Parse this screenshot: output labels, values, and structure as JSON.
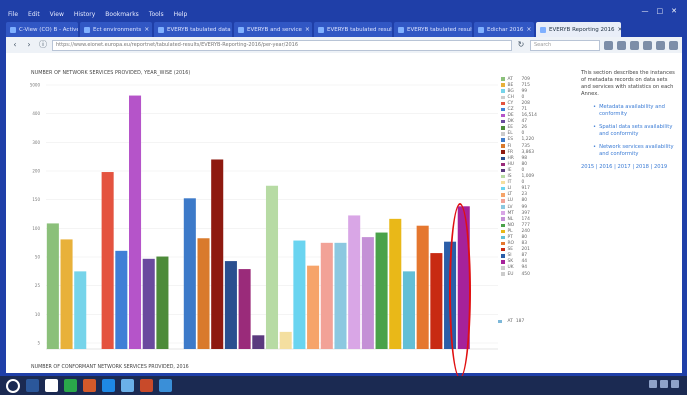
{
  "browser": {
    "menu": [
      "File",
      "Edit",
      "View",
      "History",
      "Bookmarks",
      "Tools",
      "Help"
    ],
    "window_controls": [
      "—",
      "□",
      "✕"
    ],
    "tabs": [
      {
        "label": "C-View (CO) B - Active"
      },
      {
        "label": "Ect environments"
      },
      {
        "label": "EVERYB tabulated data in"
      },
      {
        "label": "EVERYB and service"
      },
      {
        "label": "EVERYB tabulated results"
      },
      {
        "label": "EVERYB tabulated results"
      },
      {
        "label": "Edichar 2016"
      },
      {
        "label": "EVERYB Reporting 2016",
        "active": true
      }
    ],
    "url": "https://www.eionet.europa.eu/reportnet/tabulated-results/EVERYB-Reporting-2016/per-year/2016",
    "search_placeholder": "Search"
  },
  "chart1": {
    "title": "NUMBER OF NETWORK SERVICES PROVIDED, YEAR_WISE (2016)"
  },
  "chart_data": {
    "type": "bar",
    "categories": [
      "AT",
      "BE",
      "BG",
      "CH",
      "CY",
      "CZ",
      "DE",
      "DK",
      "EE",
      "EL",
      "ES",
      "FI",
      "FR",
      "HR",
      "HU",
      "IE",
      "IS",
      "IT",
      "LI",
      "LT",
      "LU",
      "LV",
      "MT",
      "NL",
      "NO",
      "PL",
      "PT",
      "RO",
      "SE",
      "SI",
      "SK",
      "UK",
      "EU"
    ],
    "values": [
      110,
      96,
      68,
      0,
      155,
      86,
      222,
      79,
      81,
      0,
      132,
      97,
      166,
      77,
      70,
      12,
      143,
      15,
      95,
      73,
      93,
      93,
      117,
      98,
      102,
      114,
      68,
      108,
      84,
      94,
      125,
      0,
      0
    ],
    "colors": [
      "#8bc07a",
      "#e8b13a",
      "#76d4ea",
      "#ffffff",
      "#e4533f",
      "#3f7fd6",
      "#b554c9",
      "#6a4a9e",
      "#4d8b3a",
      "#ffffff",
      "#3d7ac9",
      "#d97a2c",
      "#8e1a10",
      "#2a4f8f",
      "#9a2b7a",
      "#5a3a7e",
      "#b7dba4",
      "#f4dfa0",
      "#6ad4f0",
      "#f6a46a",
      "#f2a297",
      "#8cc8e0",
      "#d9a6e6",
      "#c490d6",
      "#4aa24a",
      "#e9b818",
      "#63bfd6",
      "#e5772f",
      "#c82a12",
      "#2b5ea8",
      "#a6229a",
      "#ffffff",
      "#ffffff"
    ],
    "ylim": [
      0,
      240
    ],
    "yticks": [
      "5000",
      "400",
      "300",
      "200",
      "150",
      "100",
      "50",
      "25",
      "10",
      "5"
    ],
    "legend": [
      [
        "AT",
        "709"
      ],
      [
        "BE",
        "715"
      ],
      [
        "BG",
        "99"
      ],
      [
        "CH",
        "0"
      ],
      [
        "CY",
        "208"
      ],
      [
        "CZ",
        "71"
      ],
      [
        "DE",
        "16,514"
      ],
      [
        "DK",
        "47"
      ],
      [
        "EE",
        "26"
      ],
      [
        "EL",
        "0"
      ],
      [
        "ES",
        "1,220"
      ],
      [
        "FI",
        "735"
      ],
      [
        "FR",
        "3,863"
      ],
      [
        "HR",
        "98"
      ],
      [
        "HU",
        "80"
      ],
      [
        "IE",
        "0"
      ],
      [
        "IS",
        "1,009"
      ],
      [
        "IT",
        "0"
      ],
      [
        "LI",
        "917"
      ],
      [
        "LT",
        "23"
      ],
      [
        "LU",
        "80"
      ],
      [
        "LV",
        "99"
      ],
      [
        "MT",
        "397"
      ],
      [
        "NL",
        "174"
      ],
      [
        "NO",
        "777"
      ],
      [
        "PL",
        "240"
      ],
      [
        "PT",
        "80"
      ],
      [
        "RO",
        "83"
      ],
      [
        "SE",
        "201"
      ],
      [
        "SI",
        "87"
      ],
      [
        "SK",
        "44"
      ],
      [
        "UK",
        "94"
      ],
      [
        "EU",
        "450"
      ]
    ]
  },
  "sidebar": {
    "intro": "This section describes the instances of metadata records on data sets and services with statistics on each Annex.",
    "links": [
      "Metadata availability and conformity",
      "Spatial data sets availability and conformity",
      "Network services availability and conformity"
    ],
    "years": "2015 | 2016 | 2017 | 2018 | 2019"
  },
  "chart2": {
    "title": "NUMBER OF CONFORMANT NETWORK SERVICES PROVIDED, 2016",
    "legend_first": [
      "AT",
      "187"
    ]
  }
}
